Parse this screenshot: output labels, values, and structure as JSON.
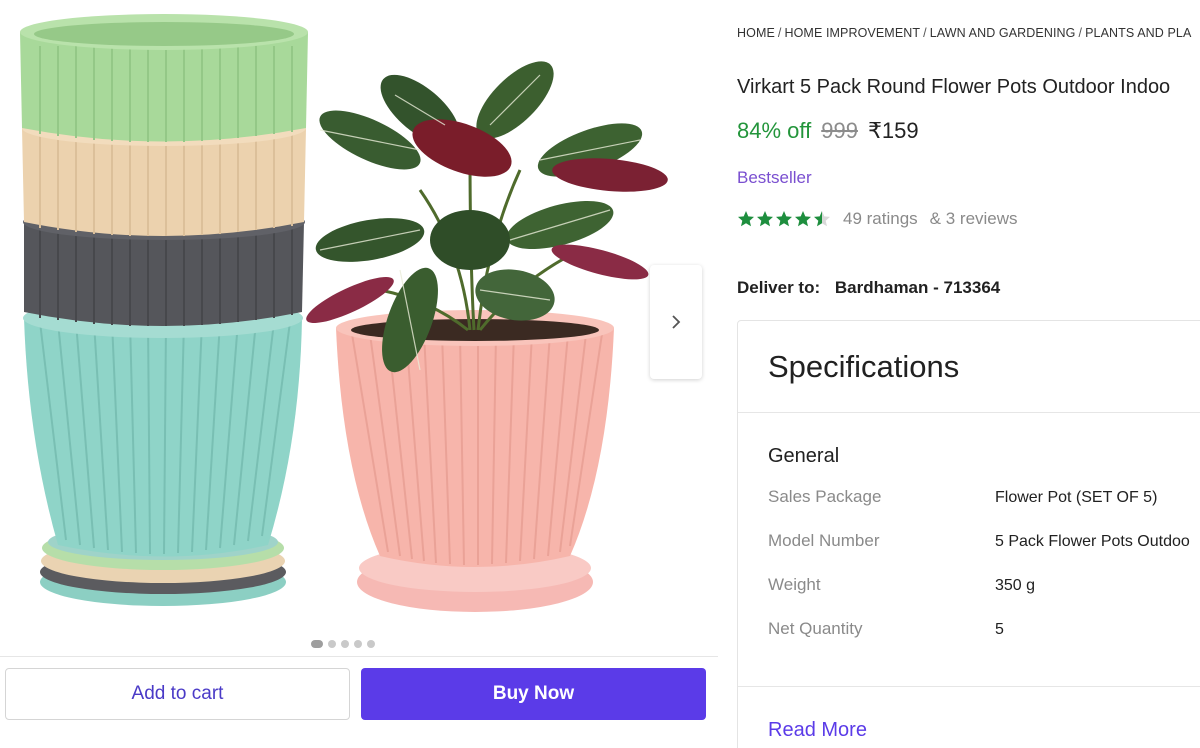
{
  "breadcrumb": [
    "Home",
    "Home Improvement",
    "Lawn and Gardening",
    "Plants and Pla"
  ],
  "product": {
    "title": "Virkart 5 Pack Round Flower Pots Outdoor Indoo",
    "discount": "84% off",
    "mrp": "999",
    "price": "₹159",
    "badge": "Bestseller",
    "rating_value": 4.5,
    "ratings_text": "49 ratings",
    "reviews_text": "& 3 reviews"
  },
  "delivery": {
    "label": "Deliver to:",
    "location": "Bardhaman - 713364"
  },
  "gallery": {
    "image_count": 5,
    "active_index": 0,
    "next_icon": "chevron-right-icon"
  },
  "actions": {
    "add_to_cart": "Add to cart",
    "buy_now": "Buy Now"
  },
  "specifications": {
    "header": "Specifications",
    "group": "General",
    "rows": [
      {
        "key": "Sales Package",
        "value": "Flower Pot (SET OF 5)"
      },
      {
        "key": "Model Number",
        "value": "5 Pack Flower Pots Outdoo"
      },
      {
        "key": "Weight",
        "value": "350 g"
      },
      {
        "key": "Net Quantity",
        "value": "5"
      }
    ],
    "read_more": "Read More"
  },
  "colors": {
    "discount_green": "#23953b",
    "brand_purple": "#5b3be8",
    "badge_purple": "#7a4fd0",
    "star_green": "#1e8e3e"
  }
}
